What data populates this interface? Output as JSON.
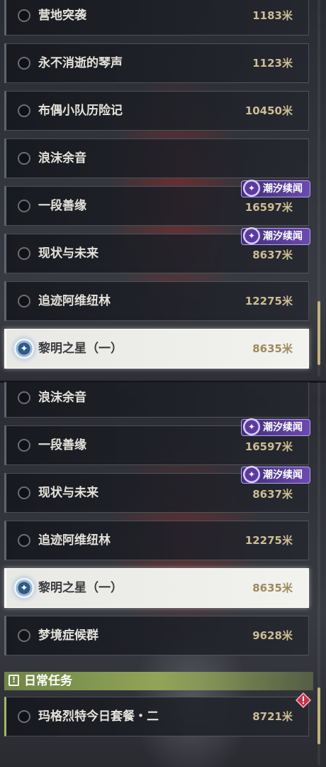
{
  "top_list": [
    {
      "name": "营地突袭",
      "distance": "1183米"
    },
    {
      "name": "永不消逝的琴声",
      "distance": "1123米"
    },
    {
      "name": "布偶小队历险记",
      "distance": "10450米"
    },
    {
      "name": "浪沫余音",
      "distance": ""
    },
    {
      "name": "一段善缘",
      "distance": "16597米",
      "badge": "潮汐续闻"
    },
    {
      "name": "现状与未来",
      "distance": "8637米",
      "badge": "潮汐续闻"
    },
    {
      "name": "追迹阿维纽林",
      "distance": "12275米"
    },
    {
      "name": "黎明之星（一）",
      "distance": "8635米",
      "selected": true
    }
  ],
  "bottom_list": [
    {
      "name": "浪沫余音",
      "distance": ""
    },
    {
      "name": "一段善缘",
      "distance": "16597米",
      "badge": "潮汐续闻"
    },
    {
      "name": "现状与未来",
      "distance": "8637米",
      "badge": "潮汐续闻"
    },
    {
      "name": "追迹阿维纽林",
      "distance": "12275米"
    },
    {
      "name": "黎明之星（一）",
      "distance": "8635米",
      "selected": true
    },
    {
      "name": "梦境症候群",
      "distance": "9628米"
    }
  ],
  "daily_section": {
    "title": "日常任务",
    "icon": "exclamation-box-icon",
    "items": [
      {
        "name": "玛格烈特今日套餐・二",
        "distance": "8721米",
        "icon": "warning-diamond-icon"
      }
    ]
  },
  "colors": {
    "distance": "#cdbd93",
    "badge": "#6b4ab0",
    "section_bar": "#90a558",
    "selected_row": "#f2f2ef",
    "warn": "#c4324a"
  },
  "icons": {
    "unselected": "radio-circle-icon",
    "selected": "location-target-icon",
    "badge": "tidal-sparkle-icon"
  }
}
